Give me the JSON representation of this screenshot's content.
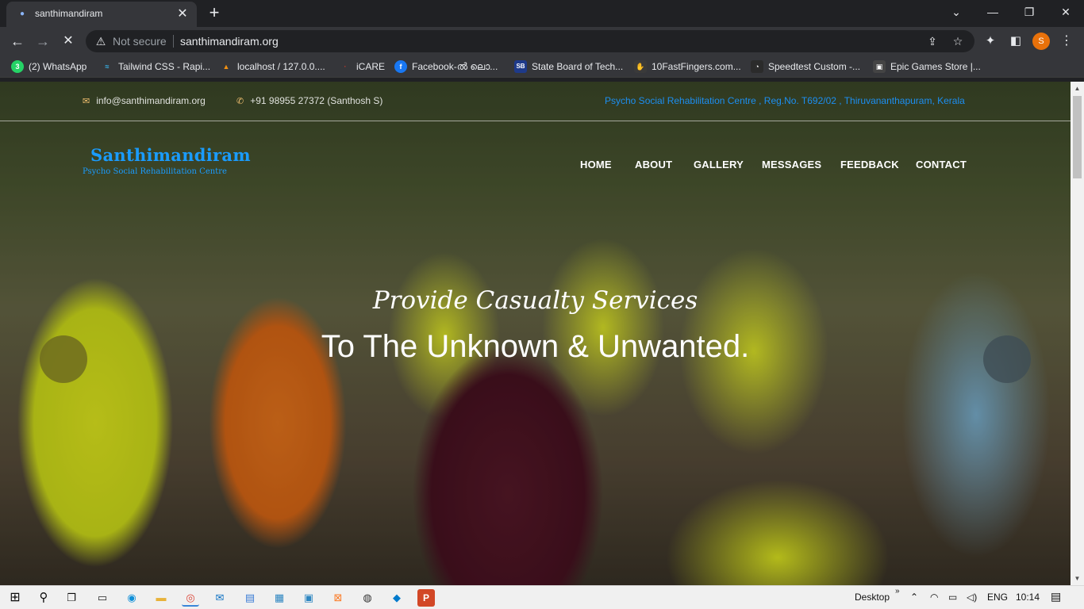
{
  "browser": {
    "tab": {
      "title": "santhimandiram",
      "close_glyph": "✕"
    },
    "new_tab_glyph": "+",
    "window_controls": [
      "⌄",
      "—",
      "❐",
      "✕"
    ],
    "nav_glyphs": {
      "back": "←",
      "forward": "→",
      "stop": "✕"
    },
    "security_label": "Not secure",
    "url": "santhimandiram.org",
    "profile_initial": "S",
    "accent_color": "#e8710a"
  },
  "bookmarks": [
    {
      "label": "(2) WhatsApp",
      "icon": "whatsapp-icon",
      "glyph": "3",
      "color": "#25d366"
    },
    {
      "label": "Tailwind CSS - Rapi...",
      "icon": "tailwind-icon",
      "glyph": "≈",
      "color": "#38bdf8"
    },
    {
      "label": "localhost / 127.0.0....",
      "icon": "phpmyadmin-icon",
      "glyph": "▲",
      "color": "#f29111"
    },
    {
      "label": "iCARE",
      "icon": "icare-icon",
      "glyph": "·",
      "color": "#c0392b"
    },
    {
      "label": "Facebook-ൽ ലൊ...",
      "icon": "facebook-icon",
      "glyph": "f",
      "color": "#1877f2"
    },
    {
      "label": "State Board of Tech...",
      "icon": "sbte-icon",
      "glyph": "SB",
      "color": "#1e3a8a"
    },
    {
      "label": "10FastFingers.com...",
      "icon": "10fastfingers-icon",
      "glyph": "✋",
      "color": "#3a3a3a"
    },
    {
      "label": "Speedtest Custom -...",
      "icon": "speedtest-icon",
      "glyph": "◔",
      "color": "#2b2b2b"
    },
    {
      "label": "Epic Games Store |...",
      "icon": "epic-games-icon",
      "glyph": "▣",
      "color": "#444"
    }
  ],
  "site": {
    "email": "info@santhimandiram.org",
    "phone": "+91 98955 27372 (Santhosh S)",
    "registration": "Psycho Social Rehabilitation Centre , Reg.No. T692/02 , Thiruvananthapuram, Kerala",
    "logo_title": "Santhimandiram",
    "logo_subtitle": "Psycho Social Rehabilitation Centre",
    "nav": [
      "HOME",
      "ABOUT",
      "GALLERY",
      "MESSAGES",
      "FEEDBACK",
      "CONTACT"
    ],
    "hero_line1": "Provide Casualty Services",
    "hero_line2": "To The Unknown & Unwanted.",
    "brand_color": "#1a9cff"
  },
  "taskbar": {
    "apps": [
      {
        "name": "windows-start-icon",
        "glyph": "⊞"
      },
      {
        "name": "search-icon",
        "glyph": "⚲"
      },
      {
        "name": "task-view-icon",
        "glyph": "❐"
      },
      {
        "name": "terminal-icon",
        "glyph": "▭"
      },
      {
        "name": "edge-icon",
        "glyph": "◉"
      },
      {
        "name": "file-explorer-icon",
        "glyph": "▬"
      },
      {
        "name": "chrome-icon",
        "glyph": "◎"
      },
      {
        "name": "mail-icon",
        "glyph": "✉"
      },
      {
        "name": "notepad-icon",
        "glyph": "▤"
      },
      {
        "name": "photos-icon",
        "glyph": "▦"
      },
      {
        "name": "remote-desktop-icon",
        "glyph": "▣"
      },
      {
        "name": "xampp-icon",
        "glyph": "⊠"
      },
      {
        "name": "obs-icon",
        "glyph": "◍"
      },
      {
        "name": "vscode-icon",
        "glyph": "◆"
      },
      {
        "name": "powerpoint-icon",
        "glyph": "P"
      }
    ],
    "desktop_label": "Desktop",
    "language": "ENG",
    "time": "10:14"
  }
}
